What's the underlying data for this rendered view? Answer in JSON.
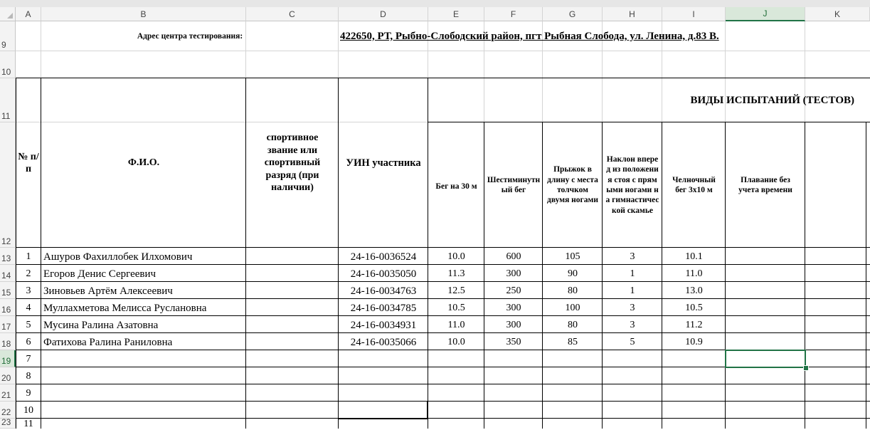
{
  "columns": [
    "A",
    "B",
    "C",
    "D",
    "E",
    "F",
    "G",
    "H",
    "I",
    "J",
    "K"
  ],
  "selected_column": "J",
  "rows": [
    "9",
    "10",
    "11",
    "12",
    "13",
    "14",
    "15",
    "16",
    "17",
    "18",
    "19",
    "20",
    "21",
    "22",
    "23"
  ],
  "selected_row": "19",
  "sheet": {
    "address_label": "Адрес центра тестирования:",
    "address_value": "422650, РТ, Рыбно-Слободский район, пгт Рыбная Слобода, ул. Ленина, д.83 В.",
    "tests_header": "ВИДЫ  ИСПЫТАНИЙ  (ТЕСТОВ)",
    "headers": {
      "num": "№ п/п",
      "fio": "Ф.И.О.",
      "rank": "спортивное звание или спортивный разряд (при наличии)",
      "uin": "УИН участника",
      "run30": "Бег на 30 м",
      "run6": "Шестиминутный бег",
      "jump": "Прыжок в длину с места толчком двумя ногами",
      "bend": "Наклон вперед из положения стоя с прямыми ногами на гимнастической скамье",
      "shuttle": "Челночный бег 3х10 м",
      "swim": "Плавание без учета времени"
    },
    "participants": [
      {
        "n": "1",
        "name": "Ашуров Фахиллобек Илхомович",
        "uin": "24-16-0036524",
        "run30": "10.0",
        "run6": "600",
        "jump": "105",
        "bend": "3",
        "shuttle": "10.1"
      },
      {
        "n": "2",
        "name": "Егоров Денис Сергеевич",
        "uin": "24-16-0035050",
        "run30": "11.3",
        "run6": "300",
        "jump": "90",
        "bend": "1",
        "shuttle": "11.0"
      },
      {
        "n": "3",
        "name": "Зиновьев Артём Алексеевич",
        "uin": "24-16-0034763",
        "run30": "12.5",
        "run6": "250",
        "jump": "80",
        "bend": "1",
        "shuttle": "13.0"
      },
      {
        "n": "4",
        "name": "Муллахметова Мелисса Руслановна",
        "uin": "24-16-0034785",
        "run30": "10.5",
        "run6": "300",
        "jump": "100",
        "bend": "3",
        "shuttle": "10.5"
      },
      {
        "n": "5",
        "name": "Мусина Ралина Азатовна",
        "uin": "24-16-0034931",
        "run30": "11.0",
        "run6": "300",
        "jump": "80",
        "bend": "3",
        "shuttle": "11.2"
      },
      {
        "n": "6",
        "name": "Фатихова Ралина Раниловна",
        "uin": "24-16-0035066",
        "run30": "10.0",
        "run6": "350",
        "jump": "85",
        "bend": "5",
        "shuttle": "10.9"
      }
    ],
    "empty_numbers": [
      "7",
      "8",
      "9",
      "10",
      "11"
    ]
  }
}
